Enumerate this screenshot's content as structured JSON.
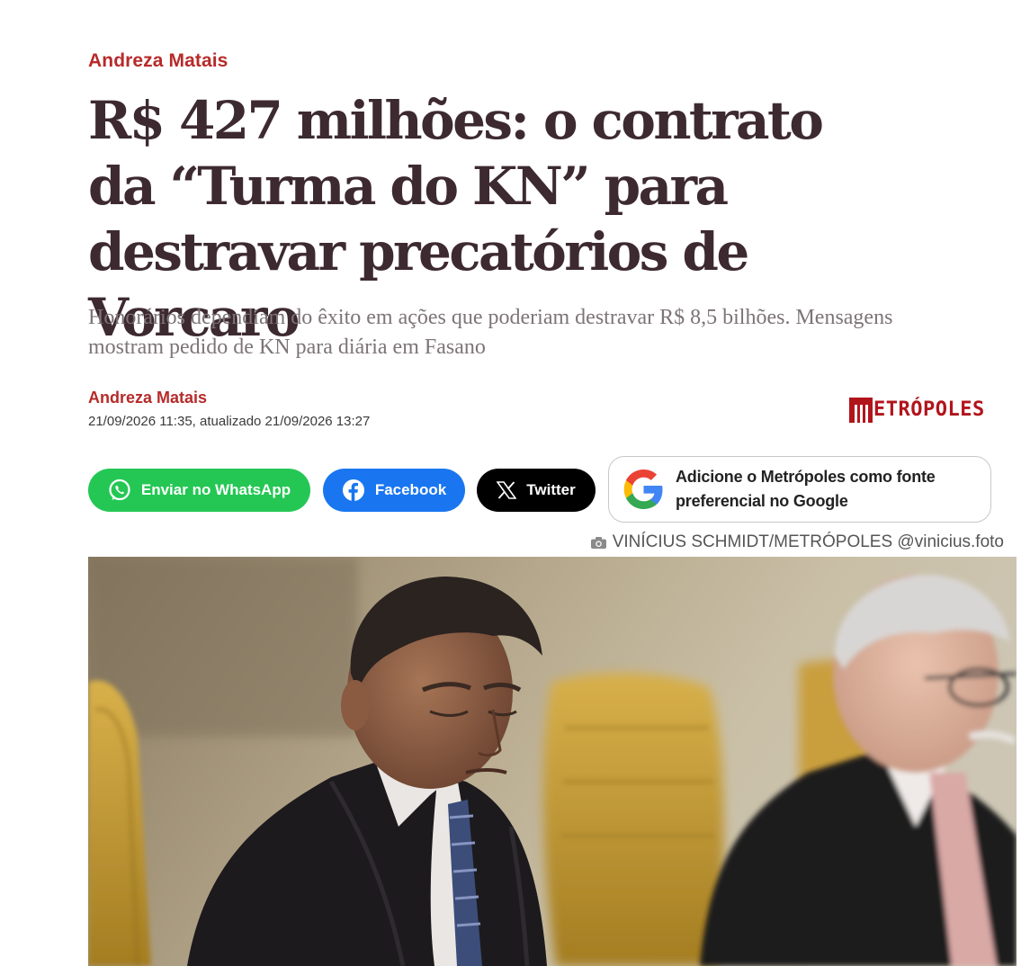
{
  "article": {
    "kicker": "Andreza Matais",
    "headline": "R$ 427 milhões: o contrato da “Turma do KN” para destravar precatórios de Vorcaro",
    "subtitle": "Honorários dependiam do êxito em ações que poderiam destravar R$ 8,5 bilhões. Mensagens mostram pedido de KN para diária em Fasano",
    "author": "Andreza Matais",
    "dateline": "21/09/2026 11:35, atualizado 21/09/2026 13:27"
  },
  "brand": {
    "name": "METRÓPOLES",
    "text": "ETRÓPOLES",
    "color": "#b2141c"
  },
  "share": {
    "whatsapp_label": "Enviar no WhatsApp",
    "facebook_label": "Facebook",
    "twitter_label": "Twitter",
    "whatsapp_color": "#24c754",
    "facebook_color": "#1976f0",
    "twitter_color": "#000000"
  },
  "google_source": {
    "label": "Adicione o Metrópoles como fonte preferencial no Google",
    "icon": "google-g-icon"
  },
  "photo": {
    "credit": "VINÍCIUS SCHMIDT/METRÓPOLES @vinicius.foto",
    "credit_icon": "camera-icon"
  }
}
